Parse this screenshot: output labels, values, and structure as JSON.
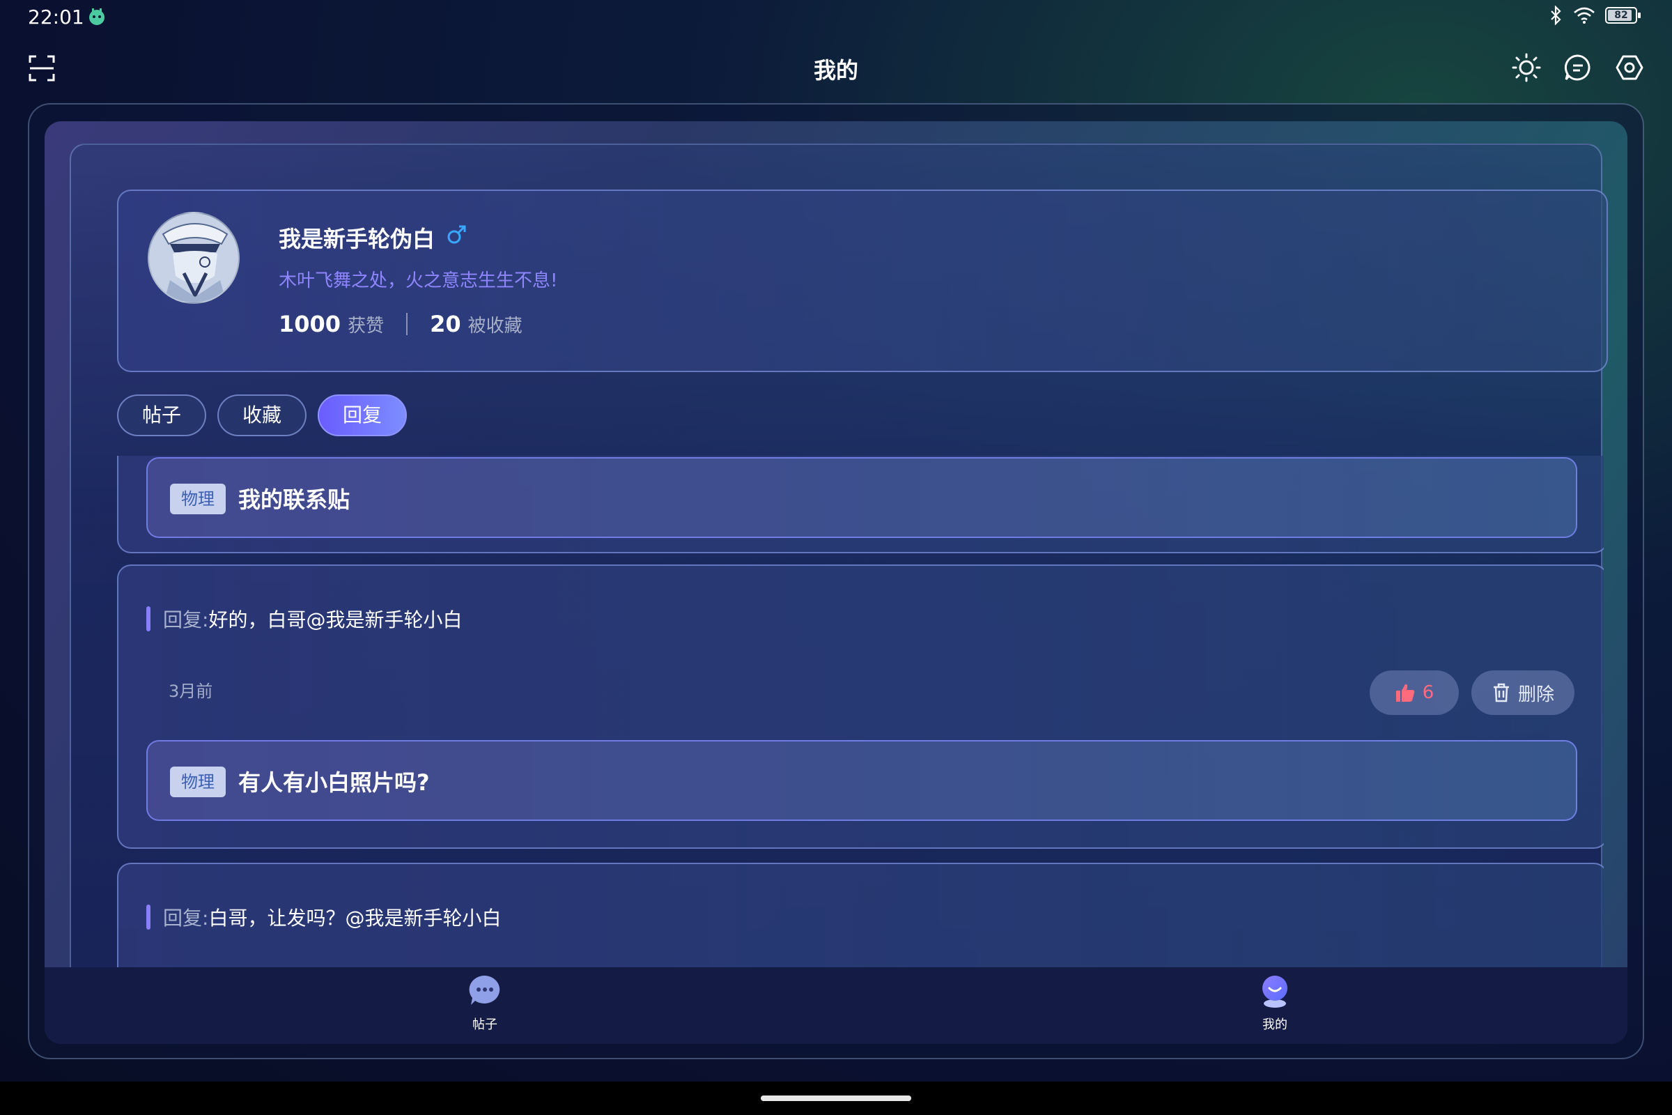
{
  "status_bar": {
    "time": "22:01",
    "battery": "82"
  },
  "header": {
    "title": "我的"
  },
  "profile": {
    "username": "我是新手轮伪白",
    "bio": "木叶飞舞之处，火之意志生生不息!",
    "likes_count": "1000",
    "likes_label": "获赞",
    "favorited_count": "20",
    "favorited_label": "被收藏"
  },
  "tabs": [
    {
      "label": "帖子"
    },
    {
      "label": "收藏"
    },
    {
      "label": "回复",
      "active": true
    }
  ],
  "replies": [
    {
      "post_tag": "物理",
      "post_title": "我的联系贴"
    },
    {
      "reply_prefix": "回复:",
      "reply_text": "好的，白哥@我是新手轮小白",
      "time": "3月前",
      "likes": "6",
      "delete_label": "删除",
      "post_tag": "物理",
      "post_title": "有人有小白照片吗?"
    },
    {
      "reply_prefix": "回复:",
      "reply_text": "白哥，让发吗？@我是新手轮小白"
    }
  ],
  "bottom_nav": [
    {
      "label": "帖子"
    },
    {
      "label": "我的",
      "active": true
    }
  ],
  "colors": {
    "accent": "#6a5cff",
    "like": "#ff6b7d",
    "bio": "#8f86ff",
    "male": "#3aa7ff"
  }
}
